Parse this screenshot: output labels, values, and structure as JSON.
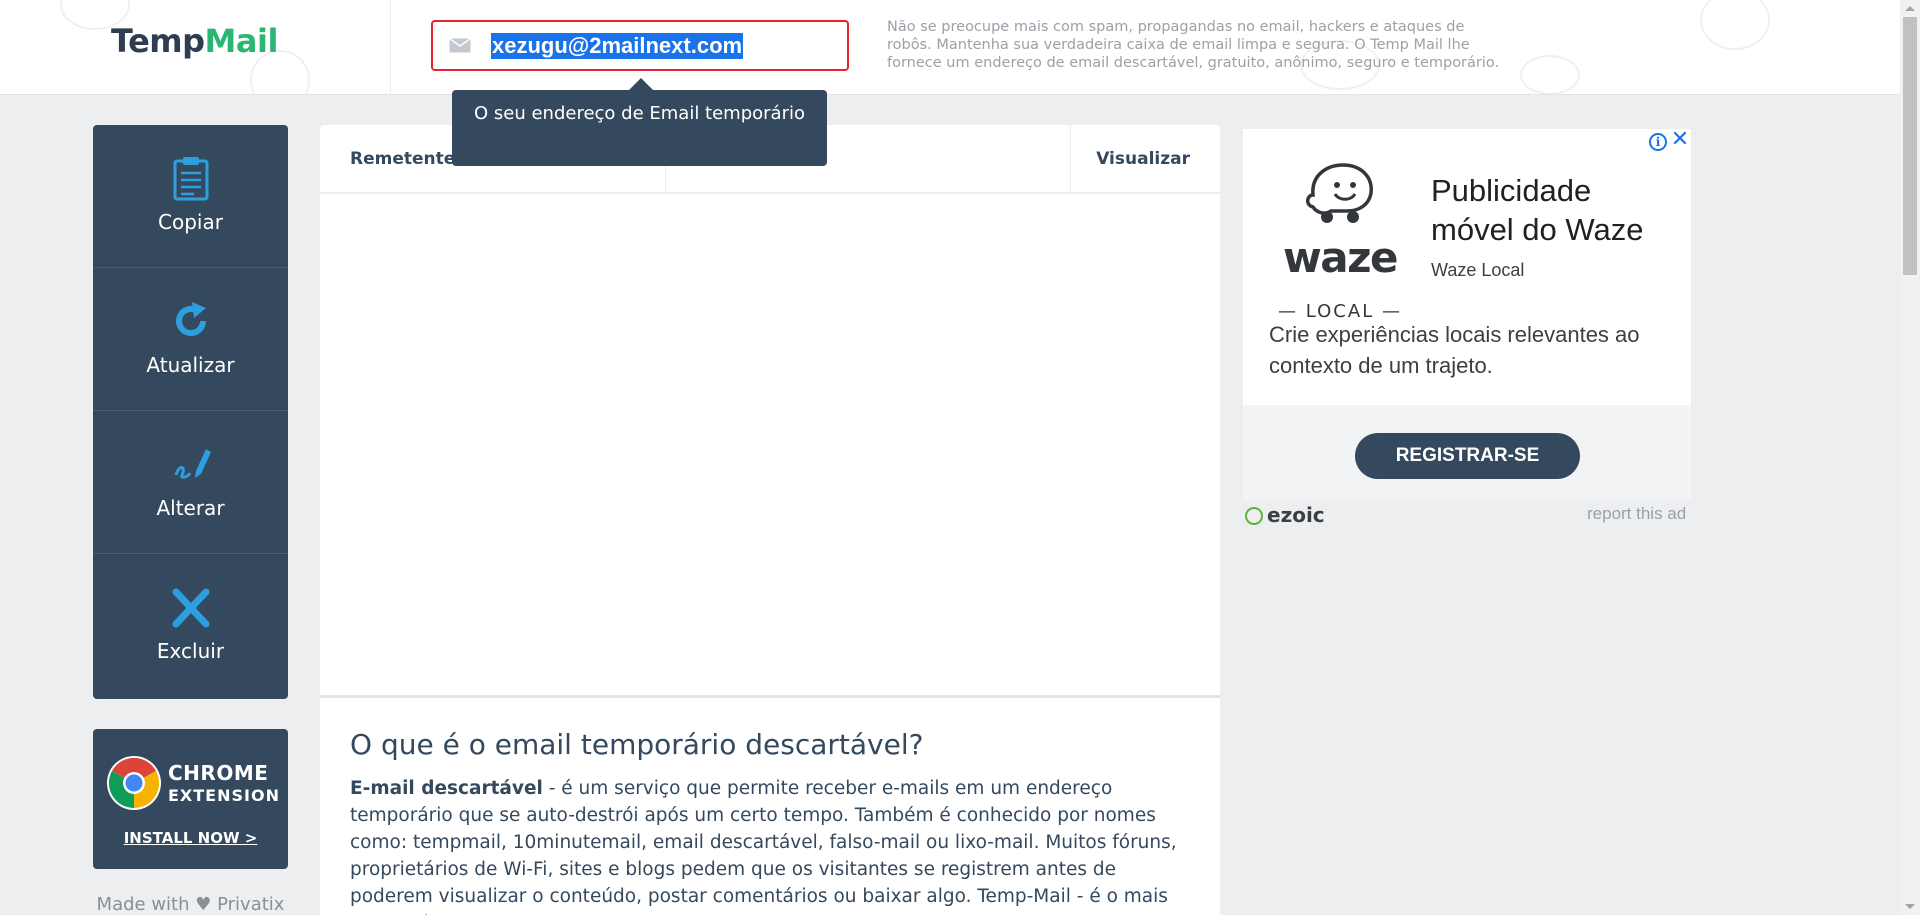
{
  "header": {
    "logo_part1": "Temp",
    "logo_part2": "Mail",
    "email": "xezugu@2mailnext.com",
    "description": "Não se preocupe mais com spam, propagandas no email, hackers e ataques de robôs. Mantenha sua verdadeira caixa de email limpa e segura. O Temp Mail lhe fornece um endereço de email descartável, gratuito, anônimo, seguro e temporário."
  },
  "tooltip": {
    "text": "O seu endereço de Email temporário"
  },
  "actions": [
    {
      "label": "Copiar",
      "icon": "clipboard-icon"
    },
    {
      "label": "Atualizar",
      "icon": "refresh-icon"
    },
    {
      "label": "Alterar",
      "icon": "edit-icon"
    },
    {
      "label": "Excluir",
      "icon": "delete-icon"
    }
  ],
  "chrome_extension": {
    "line1": "CHROME",
    "line2": "EXTENSION",
    "cta": "INSTALL NOW >"
  },
  "made_with": "Made with ♥ Privatix",
  "inbox": {
    "col_sender": "Remetente",
    "col_view": "Visualizar"
  },
  "article": {
    "title": "O que é o email temporário descartável?",
    "lead_bold": "E-mail descartável",
    "body": " - é um serviço que permite receber e-mails em um endereço temporário que se auto-destrói após um certo tempo. Também é conhecido por nomes como: tempmail, 10minutemail, email descartável, falso-mail ou lixo-mail. Muitos fóruns, proprietários de Wi-Fi, sites e blogs pedem que os visitantes se registrem antes de poderem visualizar o conteúdo, postar comentários ou baixar algo. Temp-Mail - é o mais avançado"
  },
  "ad": {
    "brand_name": "waze",
    "brand_local": "— LOCAL —",
    "title": "Publicidade móvel do Waze",
    "subtitle": "Waze Local",
    "body": "Crie experiências locais relevantes ao contexto de um trajeto.",
    "button": "REGISTRAR-SE",
    "network": "ezoic",
    "report": "report this ad"
  },
  "colors": {
    "panel": "#34495e",
    "accent_green": "#2bb673",
    "icon_blue": "#2d9ee0",
    "highlight": "#1a73e8",
    "email_border": "#e8212f"
  }
}
